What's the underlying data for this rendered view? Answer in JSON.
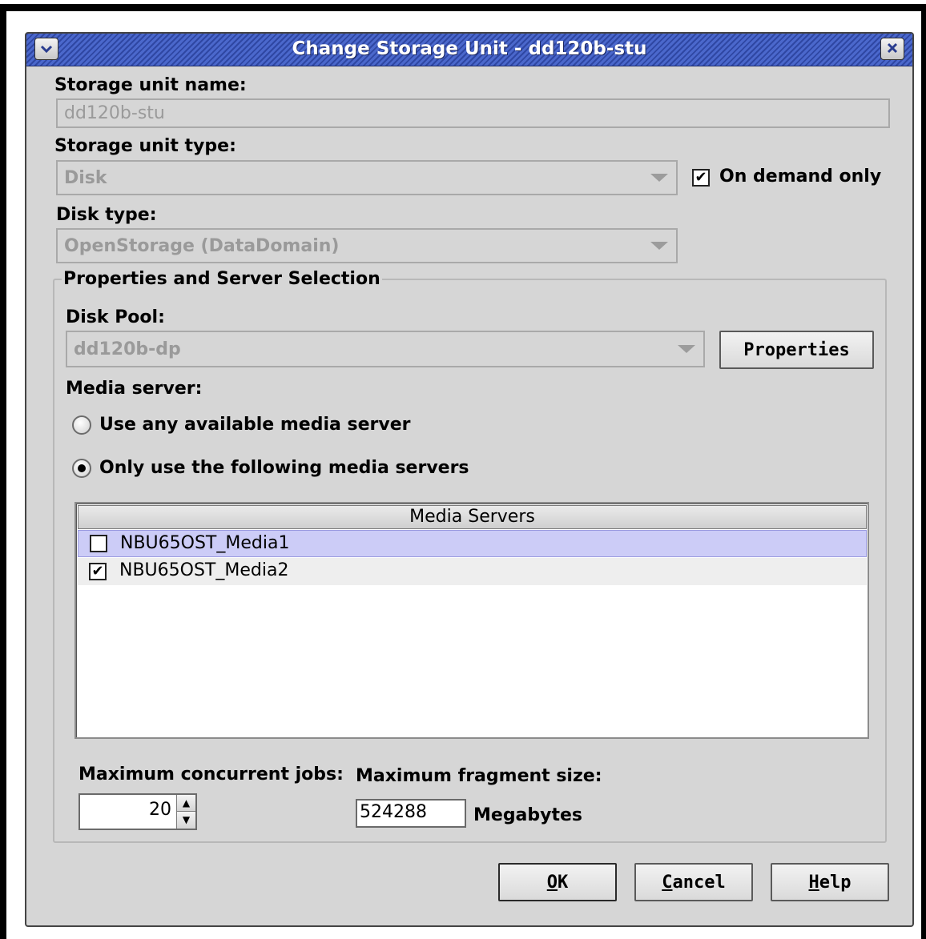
{
  "window": {
    "title": "Change Storage Unit - dd120b-stu",
    "menu_icon": "chevron-down-icon",
    "close_icon": "close-icon"
  },
  "storage_unit_name": {
    "label": "Storage unit name:",
    "value": "dd120b-stu"
  },
  "storage_unit_type": {
    "label": "Storage unit type:",
    "value": "Disk"
  },
  "on_demand_only": {
    "label": "On demand only",
    "checked": true
  },
  "disk_type": {
    "label": "Disk type:",
    "value": "OpenStorage (DataDomain)"
  },
  "properties_group": {
    "title": "Properties and Server Selection",
    "disk_pool_label": "Disk Pool:",
    "disk_pool_value": "dd120b-dp",
    "properties_button": "Properties",
    "media_server_label": "Media server:",
    "radio_any": "Use any available media server",
    "radio_only": "Only use the following media servers",
    "selected_radio": "only"
  },
  "media_servers_table": {
    "header": "Media Servers",
    "rows": [
      {
        "name": "NBU65OST_Media1",
        "checked": false,
        "highlighted": true
      },
      {
        "name": "NBU65OST_Media2",
        "checked": true,
        "highlighted": false
      }
    ]
  },
  "limits": {
    "max_jobs_label": "Maximum concurrent jobs:",
    "max_jobs_value": "20",
    "max_fragment_label": "Maximum fragment size:",
    "max_fragment_value": "524288",
    "fragment_unit": "Megabytes"
  },
  "buttons": {
    "ok_mnemonic": "O",
    "ok_rest": "K",
    "cancel_mnemonic": "C",
    "cancel_rest": "ancel",
    "help_mnemonic": "H",
    "help_rest": "elp"
  },
  "colors": {
    "dialog_bg": "#d6d6d6",
    "titlebar": "#3a55b8",
    "row_highlight": "#ccccf7",
    "disabled_text": "#9a9a9a"
  }
}
